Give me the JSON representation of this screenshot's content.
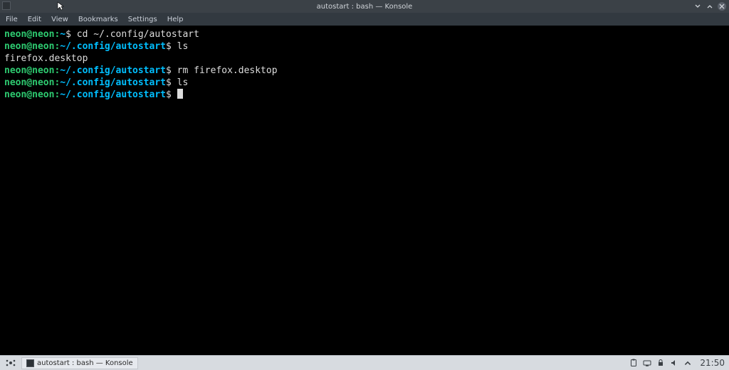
{
  "window": {
    "title": "autostart : bash — Konsole",
    "minimize_icon": "min-icon",
    "maximize_icon": "max-icon",
    "close_icon": "close-icon"
  },
  "menu": {
    "items": [
      "File",
      "Edit",
      "View",
      "Bookmarks",
      "Settings",
      "Help"
    ]
  },
  "terminal": {
    "lines": [
      {
        "user": "neon@neon",
        "path": "~",
        "cmd": "cd ~/.config/autostart"
      },
      {
        "user": "neon@neon",
        "path": "~/.config/autostart",
        "cmd": "ls"
      },
      {
        "output": "firefox.desktop"
      },
      {
        "user": "neon@neon",
        "path": "~/.config/autostart",
        "cmd": "rm firefox.desktop"
      },
      {
        "user": "neon@neon",
        "path": "~/.config/autostart",
        "cmd": "ls"
      },
      {
        "user": "neon@neon",
        "path": "~/.config/autostart",
        "cmd": "",
        "cursor": true
      }
    ]
  },
  "taskbar": {
    "active_task": "autostart : bash — Konsole",
    "clock": "21:50",
    "tray_icons": [
      "clipboard-icon",
      "network-icon",
      "lock-icon",
      "volume-icon",
      "chevron-up-icon"
    ]
  }
}
